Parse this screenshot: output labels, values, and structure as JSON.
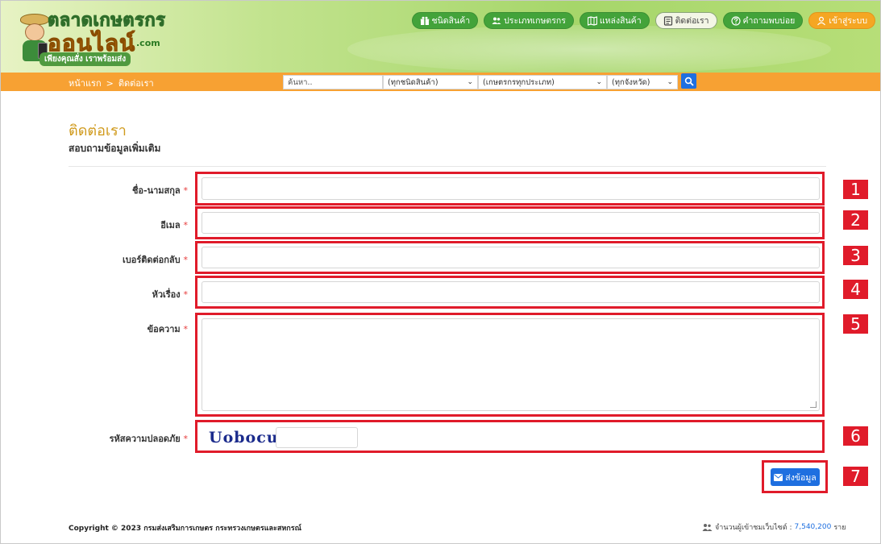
{
  "header": {
    "logo_title": "ตลาดเกษตรกร",
    "logo_online": "ออนไลน์",
    "logo_com": ".com",
    "logo_tagline": "เพียงคุณสั่ง เราพร้อมส่ง",
    "nav": [
      {
        "label": "ชนิดสินค้า",
        "icon": "gift-icon"
      },
      {
        "label": "ประเภทเกษตรกร",
        "icon": "users-icon"
      },
      {
        "label": "แหล่งสินค้า",
        "icon": "map-icon"
      },
      {
        "label": "ติดต่อเรา",
        "icon": "contact-card-icon"
      },
      {
        "label": "คำถามพบบ่อย",
        "icon": "question-icon"
      },
      {
        "label": "เข้าสู่ระบบ",
        "icon": "user-icon"
      }
    ]
  },
  "searchbar": {
    "breadcrumb_home": "หน้าแรก",
    "breadcrumb_sep": ">",
    "breadcrumb_current": "ติดต่อเรา",
    "search_placeholder": "ค้นหา..",
    "category_selected": "(ทุกชนิดสินค้า)",
    "farmer_type_selected": "(เกษตรกรทุกประเภท)",
    "province_selected": "(ทุกจังหวัด)"
  },
  "page": {
    "title": "ติดต่อเรา",
    "subtitle": "สอบถามข้อมูลเพิ่มเติม"
  },
  "form": {
    "required_mark": "*",
    "fields": [
      {
        "label": "ชื่อ-นามสกุล",
        "value": "",
        "marker": "1"
      },
      {
        "label": "อีเมล",
        "value": "",
        "marker": "2"
      },
      {
        "label": "เบอร์ติดต่อกลับ",
        "value": "",
        "marker": "3"
      },
      {
        "label": "หัวเรื่อง",
        "value": "",
        "marker": "4"
      },
      {
        "label": "ข้อความ",
        "value": "",
        "marker": "5"
      },
      {
        "label": "รหัสความปลอดภัย",
        "value": "",
        "marker": "6"
      }
    ],
    "captcha": "Uobocu",
    "submit_label": "ส่งข้อมูล",
    "submit_marker": "7"
  },
  "footer": {
    "copyright": "Copyright © 2023 กรมส่งเสริมการเกษตร กระทรวงเกษตรและสหกรณ์",
    "visitors_label": "จำนวนผู้เข้าชมเว็บไซต์ :",
    "visitors_count": "7,540,200",
    "visitors_unit": "ราย"
  },
  "colors": {
    "accent_orange": "#f7a133",
    "nav_green": "#43a33a",
    "title_gold": "#d09a1c",
    "marker_red": "#e01b2a",
    "button_blue": "#1e6fe0"
  }
}
